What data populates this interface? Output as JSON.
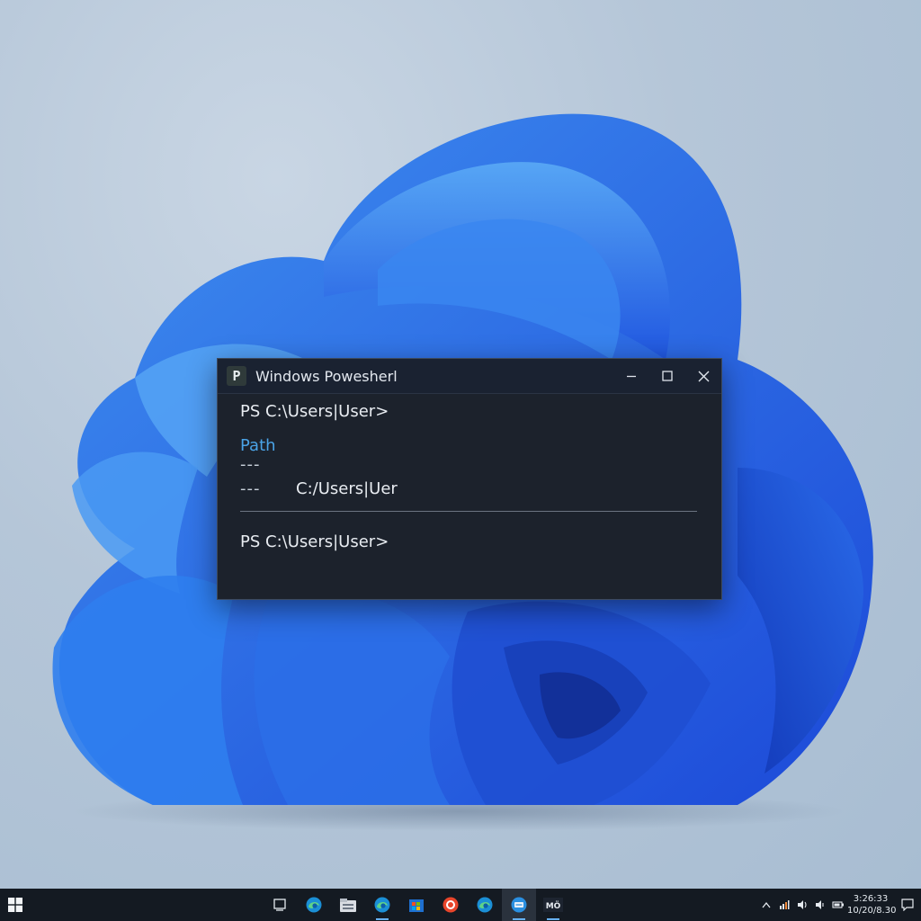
{
  "window": {
    "title": "Windows Powesherl",
    "app_icon_glyph": "P",
    "controls": [
      "minimize-icon",
      "maximize-icon",
      "close-icon"
    ]
  },
  "terminal": {
    "prompt1": "PS C:\\Users|User>",
    "column_header": "Path",
    "header_underline": "---",
    "value_dashes": "---",
    "value": "C:/Users|Uer",
    "prompt2": "PS C:\\Users|User>"
  },
  "taskbar": {
    "start_icon": "windows-logo-icon",
    "apps": [
      {
        "icon": "task-view-icon",
        "active": false,
        "running": false
      },
      {
        "icon": "edge-icon",
        "active": false,
        "running": false
      },
      {
        "icon": "file-explorer-icon",
        "active": false,
        "running": false
      },
      {
        "icon": "edge-icon",
        "active": false,
        "running": true
      },
      {
        "icon": "store-icon",
        "active": false,
        "running": false
      },
      {
        "icon": "office-icon",
        "active": false,
        "running": false
      },
      {
        "icon": "edge-icon",
        "active": false,
        "running": false
      },
      {
        "icon": "terminal-icon",
        "active": true,
        "running": true
      },
      {
        "icon": "powershell-icon",
        "active": false,
        "running": true
      }
    ],
    "tray_icons": [
      "chevron-up-icon",
      "network-icon",
      "volume-icon",
      "speaker-icon",
      "battery-icon"
    ],
    "clock_time": "3:26:33",
    "clock_date": "10/20/8.30"
  },
  "colors": {
    "terminal_bg": "#1c222c",
    "accent_blue": "#4aa3e6",
    "taskbar_bg": "#141a22"
  }
}
